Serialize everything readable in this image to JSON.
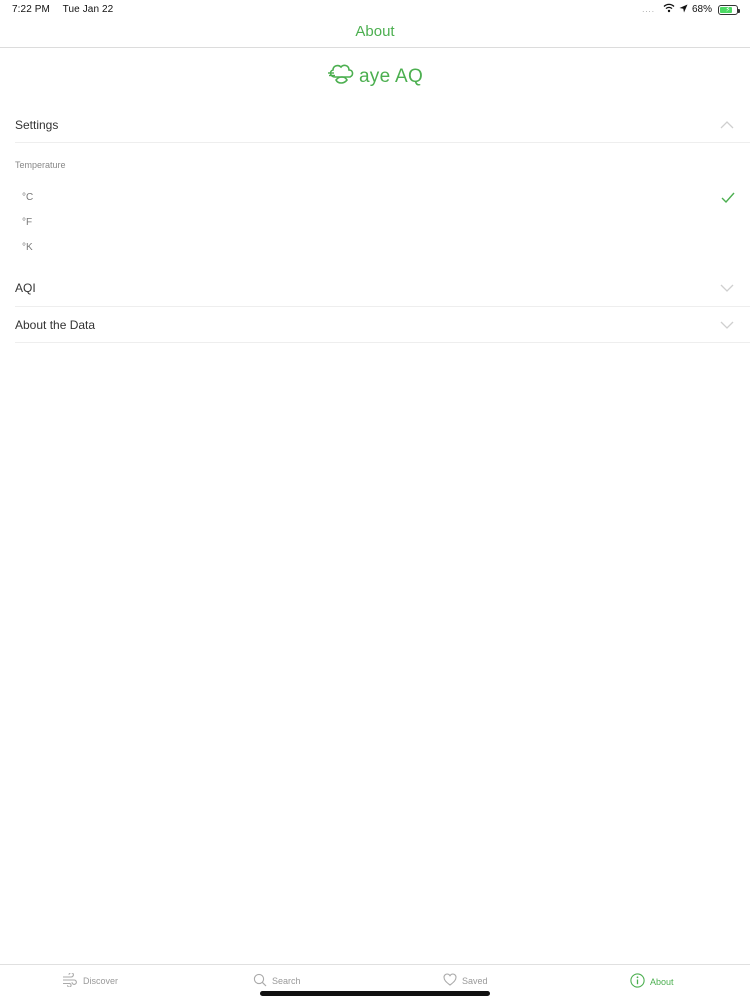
{
  "status_bar": {
    "time": "7:22 PM",
    "date": "Tue Jan 22",
    "battery_text": "68%",
    "battery_level": 0.68,
    "dots": "....",
    "icons": [
      "wifi-icon",
      "location-arrow-icon",
      "battery-icon"
    ]
  },
  "nav": {
    "title": "About"
  },
  "logo": {
    "text": "aye AQ",
    "icon": "leaf-cloud-logo-icon"
  },
  "settings": {
    "label": "Settings",
    "expanded": true,
    "temperature": {
      "heading": "Temperature",
      "options": [
        {
          "label": "°C",
          "selected": true
        },
        {
          "label": "°F",
          "selected": false
        },
        {
          "label": "°K",
          "selected": false
        }
      ]
    }
  },
  "sections": [
    {
      "label": "AQI",
      "expanded": false
    },
    {
      "label": "About the Data",
      "expanded": false
    }
  ],
  "tab_bar": {
    "tabs": [
      {
        "label": "Discover",
        "icon": "wind-icon",
        "active": false
      },
      {
        "label": "Search",
        "icon": "search-icon",
        "active": false
      },
      {
        "label": "Saved",
        "icon": "heart-icon",
        "active": false
      },
      {
        "label": "About",
        "icon": "info-icon",
        "active": true
      }
    ]
  },
  "colors": {
    "accent": "#4caf50",
    "text": "#333333",
    "muted": "#999999",
    "divider": "#eeeeee"
  }
}
